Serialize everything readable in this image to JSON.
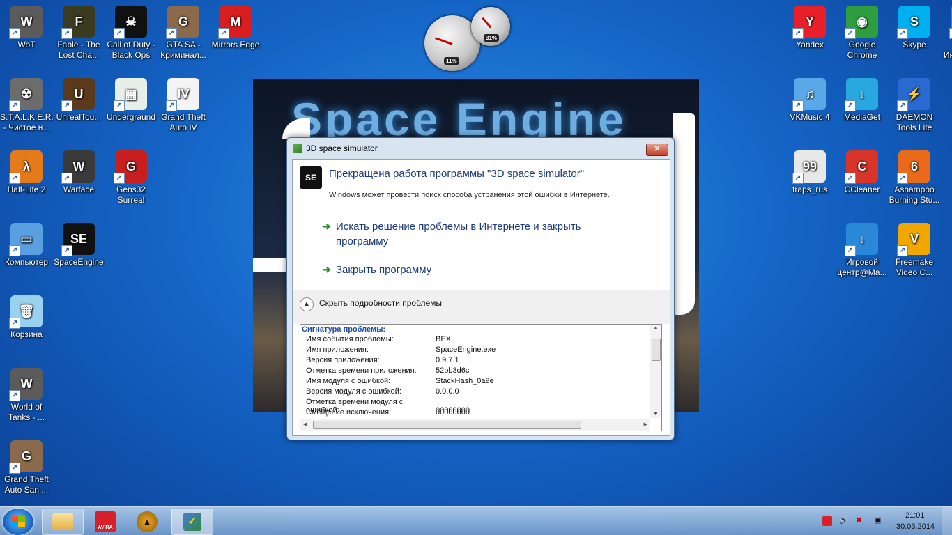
{
  "desktop_icons_left": [
    {
      "label": "WoT",
      "col": 0,
      "row": 0,
      "color": "#5b5b5b",
      "glyph": "W"
    },
    {
      "label": "Fable - The Lost Cha...",
      "col": 1,
      "row": 0,
      "color": "#3b3b20",
      "glyph": "F"
    },
    {
      "label": "Call of Duty - Black Ops",
      "col": 2,
      "row": 0,
      "color": "#111",
      "glyph": "☠"
    },
    {
      "label": "GTA SA - Криминал...",
      "col": 3,
      "row": 0,
      "color": "#8a6a4a",
      "glyph": "G"
    },
    {
      "label": "Mirrors Edge",
      "col": 4,
      "row": 0,
      "color": "#d81e1e",
      "glyph": "M"
    },
    {
      "label": "S.T.A.L.K.E.R. - Чистое н...",
      "col": 0,
      "row": 1,
      "color": "#6c6c6c",
      "glyph": "☢"
    },
    {
      "label": "UnrealTou...",
      "col": 1,
      "row": 1,
      "color": "#5a3a1a",
      "glyph": "U"
    },
    {
      "label": "Undergraund",
      "col": 2,
      "row": 1,
      "color": "#e8efe8",
      "glyph": "▦"
    },
    {
      "label": "Grand Theft Auto IV",
      "col": 3,
      "row": 1,
      "color": "#f4f4f4",
      "glyph": "IV"
    },
    {
      "label": "Half-Life 2",
      "col": 0,
      "row": 2,
      "color": "#e47a1a",
      "glyph": "λ"
    },
    {
      "label": "Warface",
      "col": 1,
      "row": 2,
      "color": "#3a3a3a",
      "glyph": "W"
    },
    {
      "label": "Gens32 Surreal",
      "col": 2,
      "row": 2,
      "color": "#c81e1e",
      "glyph": "G"
    },
    {
      "label": "Компьютер",
      "col": 0,
      "row": 3,
      "color": "#5aa0e0",
      "glyph": "▭"
    },
    {
      "label": "SpaceEngine",
      "col": 1,
      "row": 3,
      "color": "#111",
      "glyph": "SE"
    },
    {
      "label": "Корзина",
      "col": 0,
      "row": 4,
      "color": "#9ad0f0",
      "glyph": "🗑"
    },
    {
      "label": "World of Tanks - ...",
      "col": 0,
      "row": 5,
      "color": "#5b5b5b",
      "glyph": "W"
    },
    {
      "label": "Grand Theft Auto San ...",
      "col": 0,
      "row": 6,
      "color": "#8a6a4a",
      "glyph": "G"
    }
  ],
  "desktop_icons_right": [
    {
      "label": "Yandex",
      "col": 0,
      "row": 0,
      "color": "#e8202a",
      "glyph": "Y"
    },
    {
      "label": "Google Chrome",
      "col": 1,
      "row": 0,
      "color": "#2e9e3e",
      "glyph": "◉"
    },
    {
      "label": "Skype",
      "col": 2,
      "row": 0,
      "color": "#00aff0",
      "glyph": "S"
    },
    {
      "label": "VPN Интернет-...",
      "col": 3,
      "row": 0,
      "color": "#3b7dd8",
      "glyph": "▭"
    },
    {
      "label": "VKMusic 4",
      "col": 0,
      "row": 1,
      "color": "#5aa8e8",
      "glyph": "♫"
    },
    {
      "label": "MediaGet",
      "col": 1,
      "row": 1,
      "color": "#29a8e0",
      "glyph": "↓"
    },
    {
      "label": "DAEMON Tools Lite",
      "col": 2,
      "row": 1,
      "color": "#2a6ad0",
      "glyph": "⚡"
    },
    {
      "label": "fraps_rus",
      "col": 0,
      "row": 2,
      "color": "#e8e8e8",
      "glyph": "99"
    },
    {
      "label": "CCleaner",
      "col": 1,
      "row": 2,
      "color": "#d8342a",
      "glyph": "C"
    },
    {
      "label": "Ashampoo Burning Stu...",
      "col": 2,
      "row": 2,
      "color": "#e86a1a",
      "glyph": "6"
    },
    {
      "label": "Игровой центр@Ма...",
      "col": 1,
      "row": 3,
      "color": "#2a88d8",
      "glyph": "↓"
    },
    {
      "label": "Freemake Video C...",
      "col": 2,
      "row": 3,
      "color": "#f0a800",
      "glyph": "V"
    }
  ],
  "gadgets": {
    "cpu_pct": "11%",
    "mem_pct": "31%"
  },
  "splash": {
    "title": "Space Engine"
  },
  "dialog": {
    "window_title": "3D space simulator",
    "close_glyph": "✕",
    "app_icon_text": "SE",
    "heading": "Прекращена работа программы \"3D space simulator\"",
    "subtext": "Windows может провести поиск способа устранения этой ошибки в Интернете.",
    "option1": "Искать решение проблемы в Интернете и закрыть программу",
    "option2": "Закрыть программу",
    "arrow_glyph": "➜",
    "hide_details": "Скрыть подробности проблемы",
    "details_title": "Сигнатура проблемы:",
    "details": [
      {
        "k": "Имя события проблемы:",
        "v": "BEX"
      },
      {
        "k": "Имя приложения:",
        "v": "SpaceEngine.exe"
      },
      {
        "k": "Версия приложения:",
        "v": "0.9.7.1"
      },
      {
        "k": "Отметка времени приложения:",
        "v": "52bb3d6c"
      },
      {
        "k": "Имя модуля с ошибкой:",
        "v": "StackHash_0a9e"
      },
      {
        "k": "Версия модуля с ошибкой:",
        "v": "0.0.0.0"
      },
      {
        "k": "Отметка времени модуля с ошибкой:",
        "v": "00000000"
      },
      {
        "k": "Смещение исключения:",
        "v": "00000000"
      }
    ]
  },
  "taskbar": {
    "avira_label": "AVIRA",
    "time": "21:01",
    "date": "30.03.2014"
  }
}
